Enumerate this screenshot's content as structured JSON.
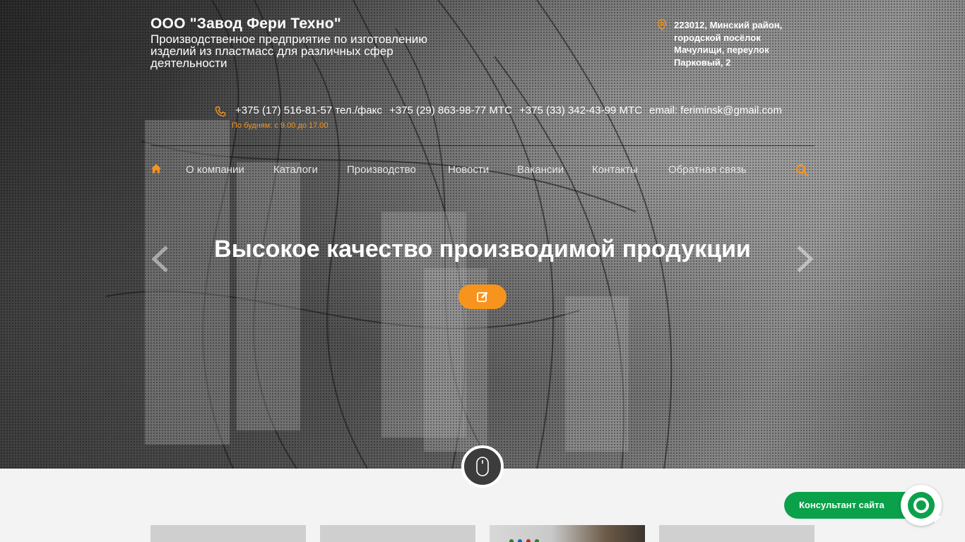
{
  "header": {
    "company_name": "ООО \"Завод Фери Техно\"",
    "company_description": "Производственное предприятие по изготовлению изделий из пластмасс для различных сфер деятельности",
    "address": "223012, Минский район, городской посёлок Мачулищи, переулок Парковый, 2",
    "phones": [
      "+375 (17) 516-81-57 тел./факс",
      "+375 (29) 863-98-77 МТС",
      "+375 (33) 342-43-99 МТС"
    ],
    "email": "email: feriminsk@gmail.com",
    "working_hours": "По будням: с 9.00 до 17.00"
  },
  "nav": {
    "items": [
      "О компании",
      "Каталоги",
      "Производство",
      "Новости",
      "Вакансии",
      "Контакты",
      "Обратная связь"
    ]
  },
  "slider": {
    "title": "Высокое качество производимой продукции"
  },
  "widget": {
    "consultant_label": "Консультант сайта"
  },
  "colors": {
    "accent": "#f7941d",
    "consultant_green": "#0aa14a"
  },
  "icons": [
    "location-pin-icon",
    "phone-icon",
    "home-icon",
    "search-icon",
    "chevron-left-icon",
    "chevron-right-icon",
    "edit-icon",
    "mouse-icon",
    "chat-icon"
  ]
}
